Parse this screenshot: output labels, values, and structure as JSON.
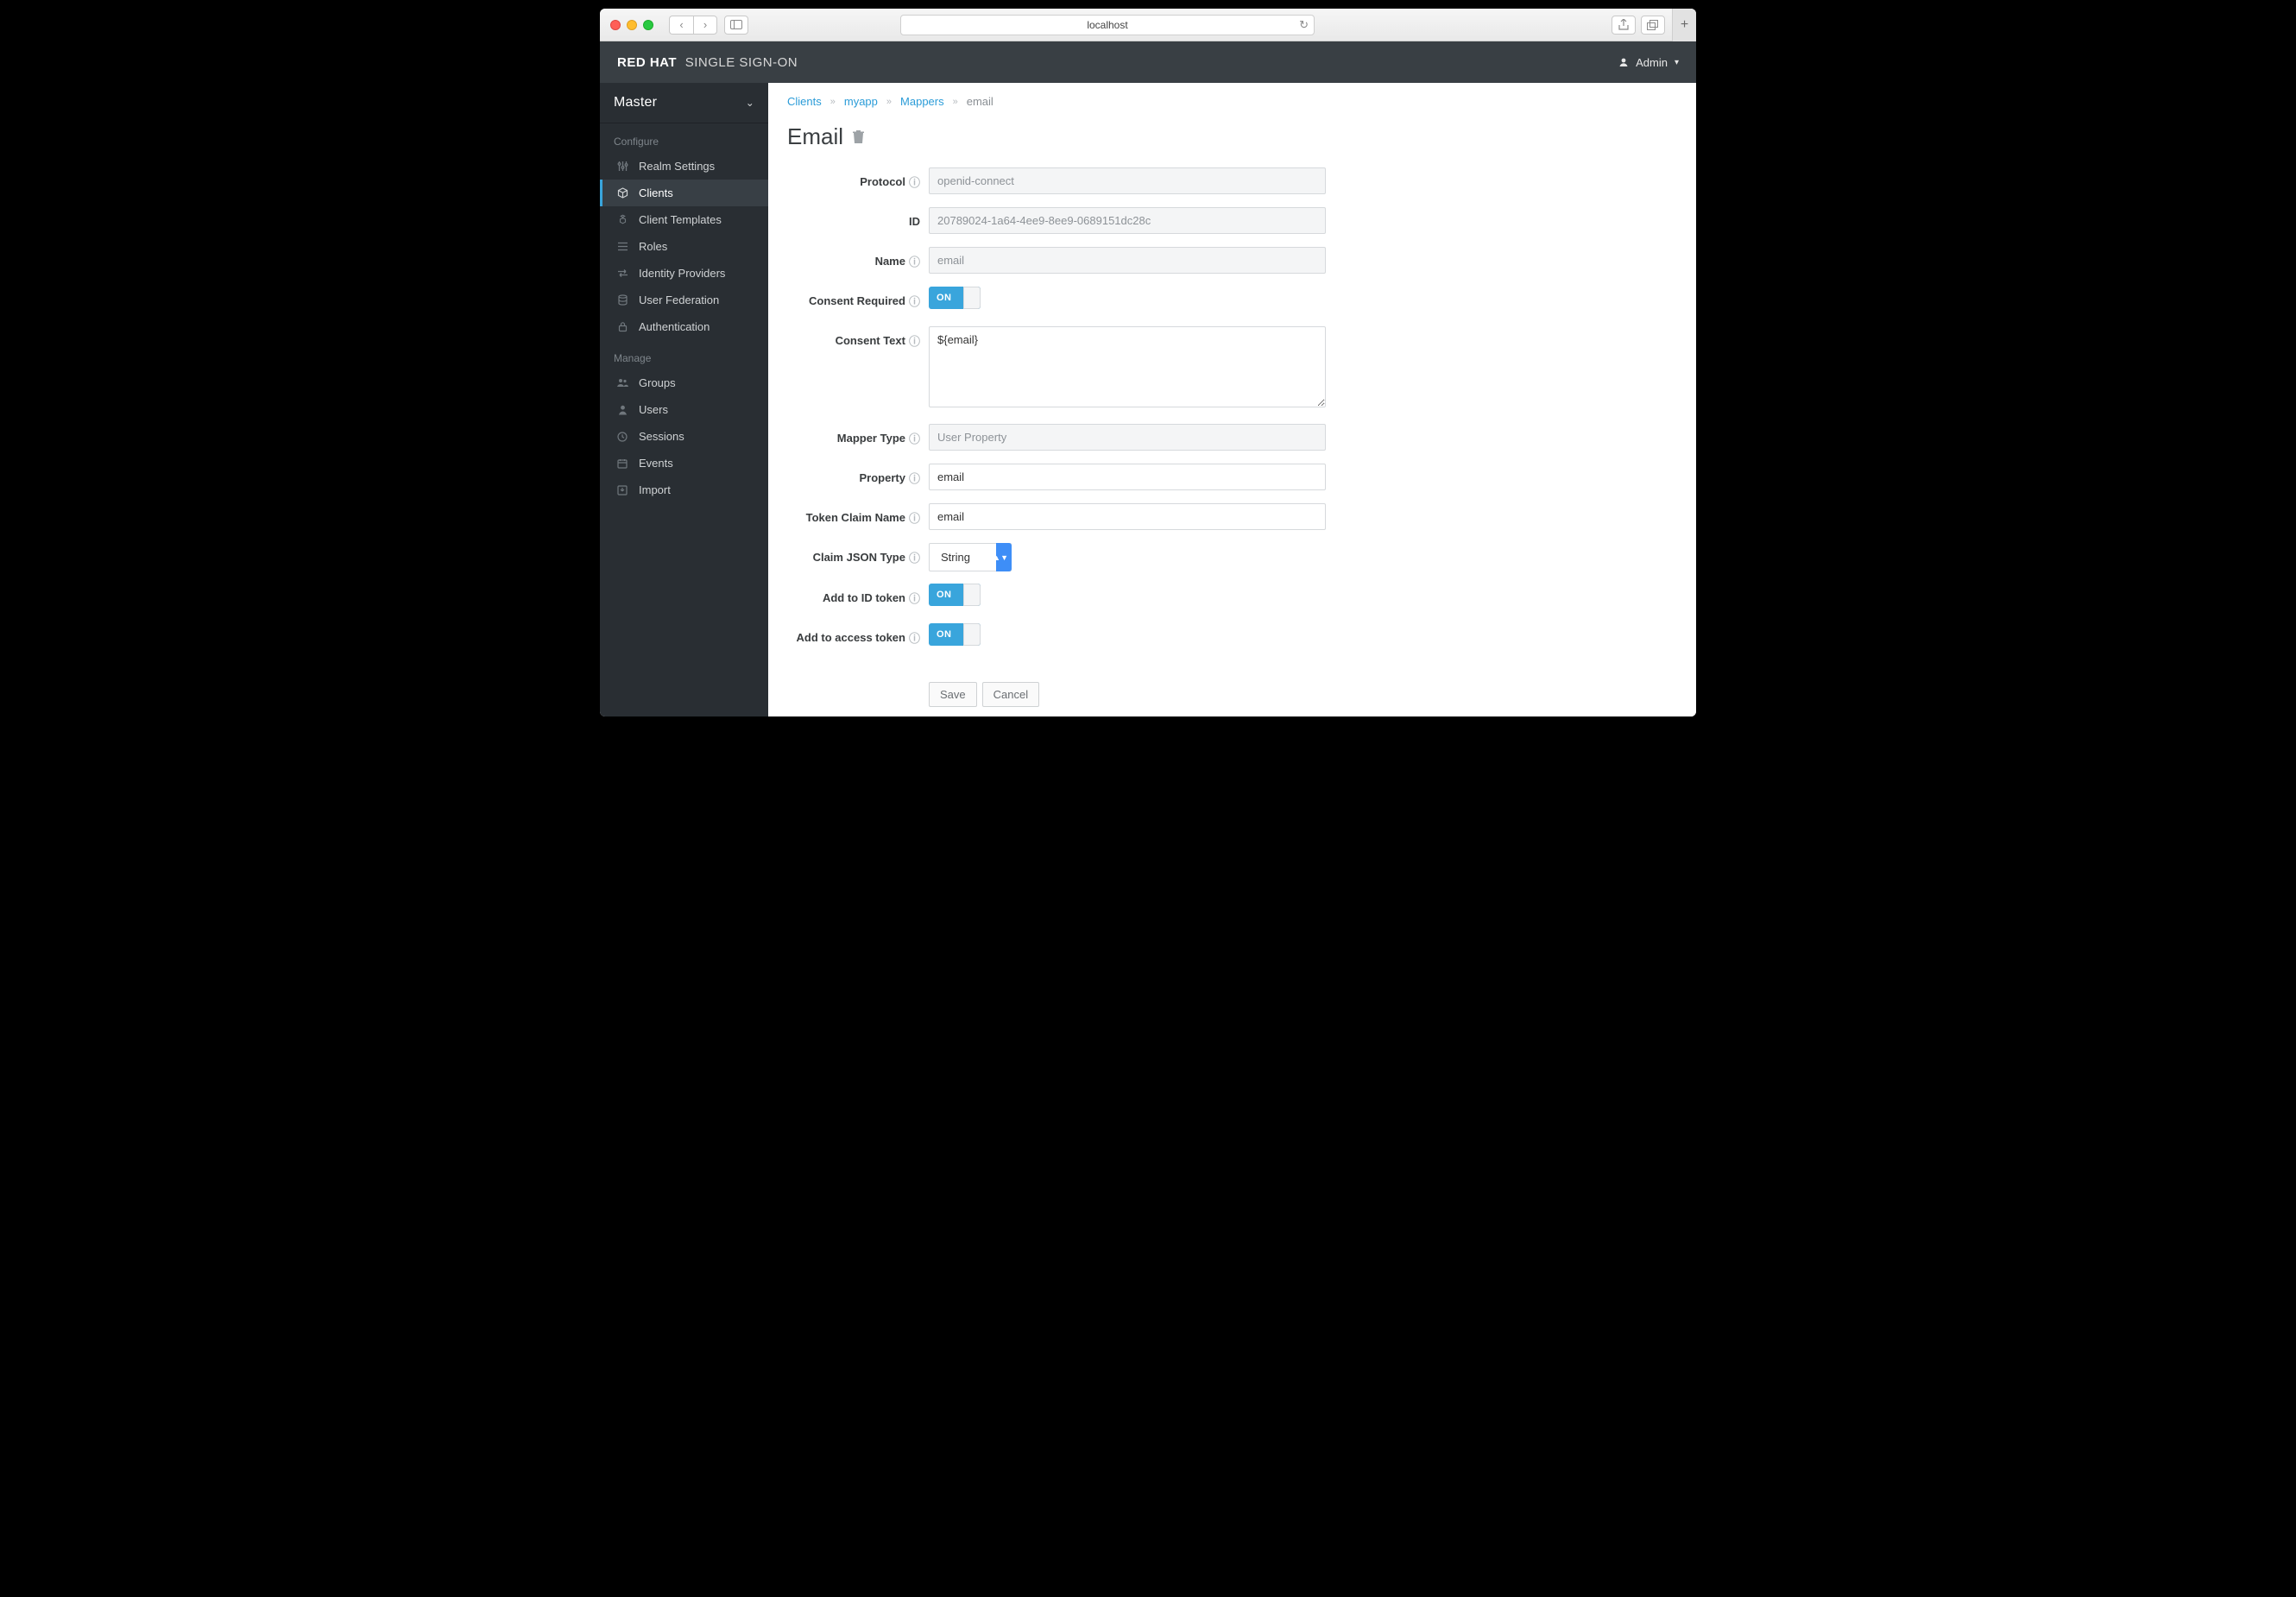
{
  "browser": {
    "url": "localhost"
  },
  "header": {
    "brand_bold": "RED HAT",
    "brand_rest": "SINGLE SIGN-ON",
    "user_label": "Admin"
  },
  "sidebar": {
    "realm": "Master",
    "section_configure": "Configure",
    "section_manage": "Manage",
    "configure": {
      "realm_settings": "Realm Settings",
      "clients": "Clients",
      "client_templates": "Client Templates",
      "roles": "Roles",
      "identity_providers": "Identity Providers",
      "user_federation": "User Federation",
      "authentication": "Authentication"
    },
    "manage": {
      "groups": "Groups",
      "users": "Users",
      "sessions": "Sessions",
      "events": "Events",
      "import": "Import"
    }
  },
  "breadcrumb": {
    "clients": "Clients",
    "client_name": "myapp",
    "mappers": "Mappers",
    "current": "email"
  },
  "page": {
    "title": "Email"
  },
  "form": {
    "labels": {
      "protocol": "Protocol",
      "id": "ID",
      "name": "Name",
      "consent_required": "Consent Required",
      "consent_text": "Consent Text",
      "mapper_type": "Mapper Type",
      "property": "Property",
      "token_claim_name": "Token Claim Name",
      "claim_json_type": "Claim JSON Type",
      "add_id_token": "Add to ID token",
      "add_access_token": "Add to access token"
    },
    "values": {
      "protocol": "openid-connect",
      "id": "20789024-1a64-4ee9-8ee9-0689151dc28c",
      "name": "email",
      "consent_text": "${email}",
      "mapper_type": "User Property",
      "property": "email",
      "token_claim_name": "email",
      "claim_json_type": "String",
      "toggle_on": "ON"
    },
    "buttons": {
      "save": "Save",
      "cancel": "Cancel"
    }
  }
}
